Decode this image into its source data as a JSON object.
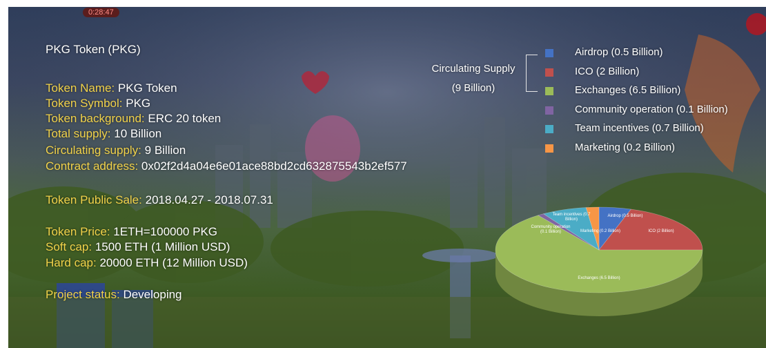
{
  "timer": "0:28:47",
  "info": {
    "title": "PKG Token (PKG)",
    "token_name": {
      "key": "Token Name:",
      "value": "PKG Token"
    },
    "token_symbol": {
      "key": "Token Symbol:",
      "value": "PKG"
    },
    "token_background": {
      "key": "Token background:",
      "value": "ERC 20 token"
    },
    "total_supply": {
      "key": "Total supply:",
      "value": "10 Billion"
    },
    "circulating_supply": {
      "key": "Circulating supply:",
      "value": "9 Billion"
    },
    "contract_address": {
      "key": "Contract address:",
      "value": "0x02f2d4a04e6e01ace88bd2cd632875543b2ef577"
    },
    "public_sale": {
      "key": "Token Public Sale:",
      "value": "2018.04.27 - 2018.07.31"
    },
    "token_price": {
      "key": "Token Price:",
      "value": "1ETH=100000 PKG"
    },
    "soft_cap": {
      "key": "Soft cap:",
      "value": "1500 ETH (1 Million USD)"
    },
    "hard_cap": {
      "key": "Hard cap:",
      "value": "20000 ETH (12 Million USD)"
    },
    "project_status": {
      "key": "Project status:",
      "value": "Developing"
    }
  },
  "legend_title": {
    "line1": "Circulating Supply",
    "line2": "(9 Billion)"
  },
  "chart_data": {
    "type": "pie",
    "title": "Circulating Supply",
    "subtitle": "(9 Billion)",
    "categories": [
      "Airdrop",
      "ICO",
      "Exchanges",
      "Community operation",
      "Team incentives",
      "Marketing"
    ],
    "values": [
      0.5,
      2,
      6.5,
      0.1,
      0.7,
      0.2
    ],
    "unit": "Billion",
    "legend": [
      "Airdrop (0.5 Billion)",
      "ICO (2 Billion)",
      "Exchanges (6.5 Billion)",
      "Community operation (0.1 Billion)",
      "Team incentives (0.7 Billion)",
      "Marketing (0.2 Billion)"
    ],
    "slice_labels": [
      "Airdrop (0.5 Billion)",
      "ICO (2 Billion)",
      "Exchanges (6.5 Billion)",
      "Community operation (0.1 Billion)",
      "Team incentives (0.7 Billion)",
      "Marketing (0.2 Billion)"
    ],
    "colors": [
      "#4472c4",
      "#c0504d",
      "#9bbb59",
      "#8064a2",
      "#4bacc6",
      "#f79646"
    ],
    "legend_placement": "top-right"
  }
}
